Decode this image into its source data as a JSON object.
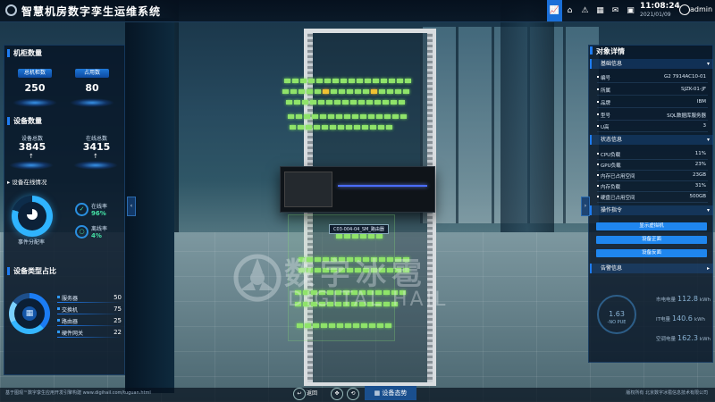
{
  "app": {
    "title": "智慧机房数字孪生运维系统",
    "time": "11:08:24",
    "date": "2021/01/09",
    "user": "admin"
  },
  "toolbar": {
    "icons": [
      "chart-icon",
      "home-icon",
      "alert-icon",
      "grid-icon",
      "mail-icon",
      "calendar-icon"
    ],
    "active": 0
  },
  "left": {
    "cabinet_title": "机柜数量",
    "cabinet_total_label": "总机柜数",
    "cabinet_total": "250",
    "cabinet_used_label": "占用数",
    "cabinet_used": "80",
    "device_title": "设备数量",
    "device_total_label": "设备总数",
    "device_total": "3845",
    "device_online_label": "在线总数",
    "device_online": "3415",
    "online_title": "设备在线情况",
    "online_rate_label": "事件分配率",
    "online_label": "在线率",
    "online_value": "96%",
    "offline_label": "离线率",
    "offline_value": "4%",
    "type_title": "设备类型占比",
    "types": [
      {
        "name": "服务器",
        "value": "50"
      },
      {
        "name": "交换机",
        "value": "75"
      },
      {
        "name": "路由器",
        "value": "25"
      },
      {
        "name": "硬件网关",
        "value": "22"
      }
    ]
  },
  "scene": {
    "rack_label": "C03-004-04_SM_路由器",
    "watermark": "数字冰雹",
    "watermark_en": "DIGITAL HAIL"
  },
  "right": {
    "title": "对象详情",
    "basic_title": "基础信息",
    "basic": [
      {
        "k": "编号",
        "v": "G2 7914AC10-01"
      },
      {
        "k": "所属",
        "v": "SJZK-01-JF"
      },
      {
        "k": "品牌",
        "v": "IBM"
      },
      {
        "k": "型号",
        "v": "SQL数据库服务器"
      },
      {
        "k": "U高",
        "v": "3"
      }
    ],
    "status_title": "状态信息",
    "status": [
      {
        "k": "CPU负载",
        "v": "11%"
      },
      {
        "k": "GPU负载",
        "v": "23%"
      },
      {
        "k": "内存已占用空间",
        "v": "23GB"
      },
      {
        "k": "内存负载",
        "v": "31%"
      },
      {
        "k": "硬盘已占用空间",
        "v": "500GB"
      }
    ],
    "ops_title": "操作指令",
    "ops": [
      "显示虚拟机",
      "设备正面",
      "设备反面"
    ],
    "alarm_title": "告警信息",
    "pue_value": "1.63",
    "pue_label": "-NO PUE",
    "metrics": [
      {
        "k": "市电电量",
        "v": "112.8",
        "u": "kWh"
      },
      {
        "k": "IT电量",
        "v": "140.6",
        "u": "kWh"
      },
      {
        "k": "空调电量",
        "v": "162.3",
        "u": "kWh"
      }
    ]
  },
  "bottom": {
    "back": "返回",
    "state": "设备态势",
    "footer_left": "基于图观™数字孪生应用开发引擎构建 www.digihail.com/tuguan.html",
    "footer_right": "版权所有 北京数字冰雹信息技术有限公司"
  },
  "colors": {
    "accent": "#1e7cf2",
    "panel_bg": "#061424",
    "led_green": "#8fe36a",
    "led_yellow": "#f1c232"
  }
}
